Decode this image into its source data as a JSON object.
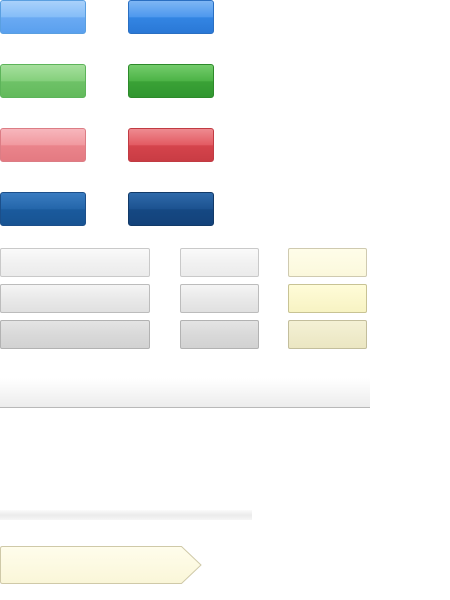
{
  "sprite_sheet": {
    "description_visible_text": "",
    "rows": [
      {
        "left": "blue-light",
        "right": "blue-strong"
      },
      {
        "left": "green-light",
        "right": "green-strong"
      },
      {
        "left": "red-light",
        "right": "red-strong"
      },
      {
        "left": "navy-light",
        "right": "navy-strong"
      }
    ],
    "colors": {
      "blue": "#4d98ee",
      "green": "#4cb346",
      "red": "#e35a62",
      "navy": "#1c5290",
      "gray": "#e9e9e9",
      "yellow": "#f7f3c3"
    }
  }
}
